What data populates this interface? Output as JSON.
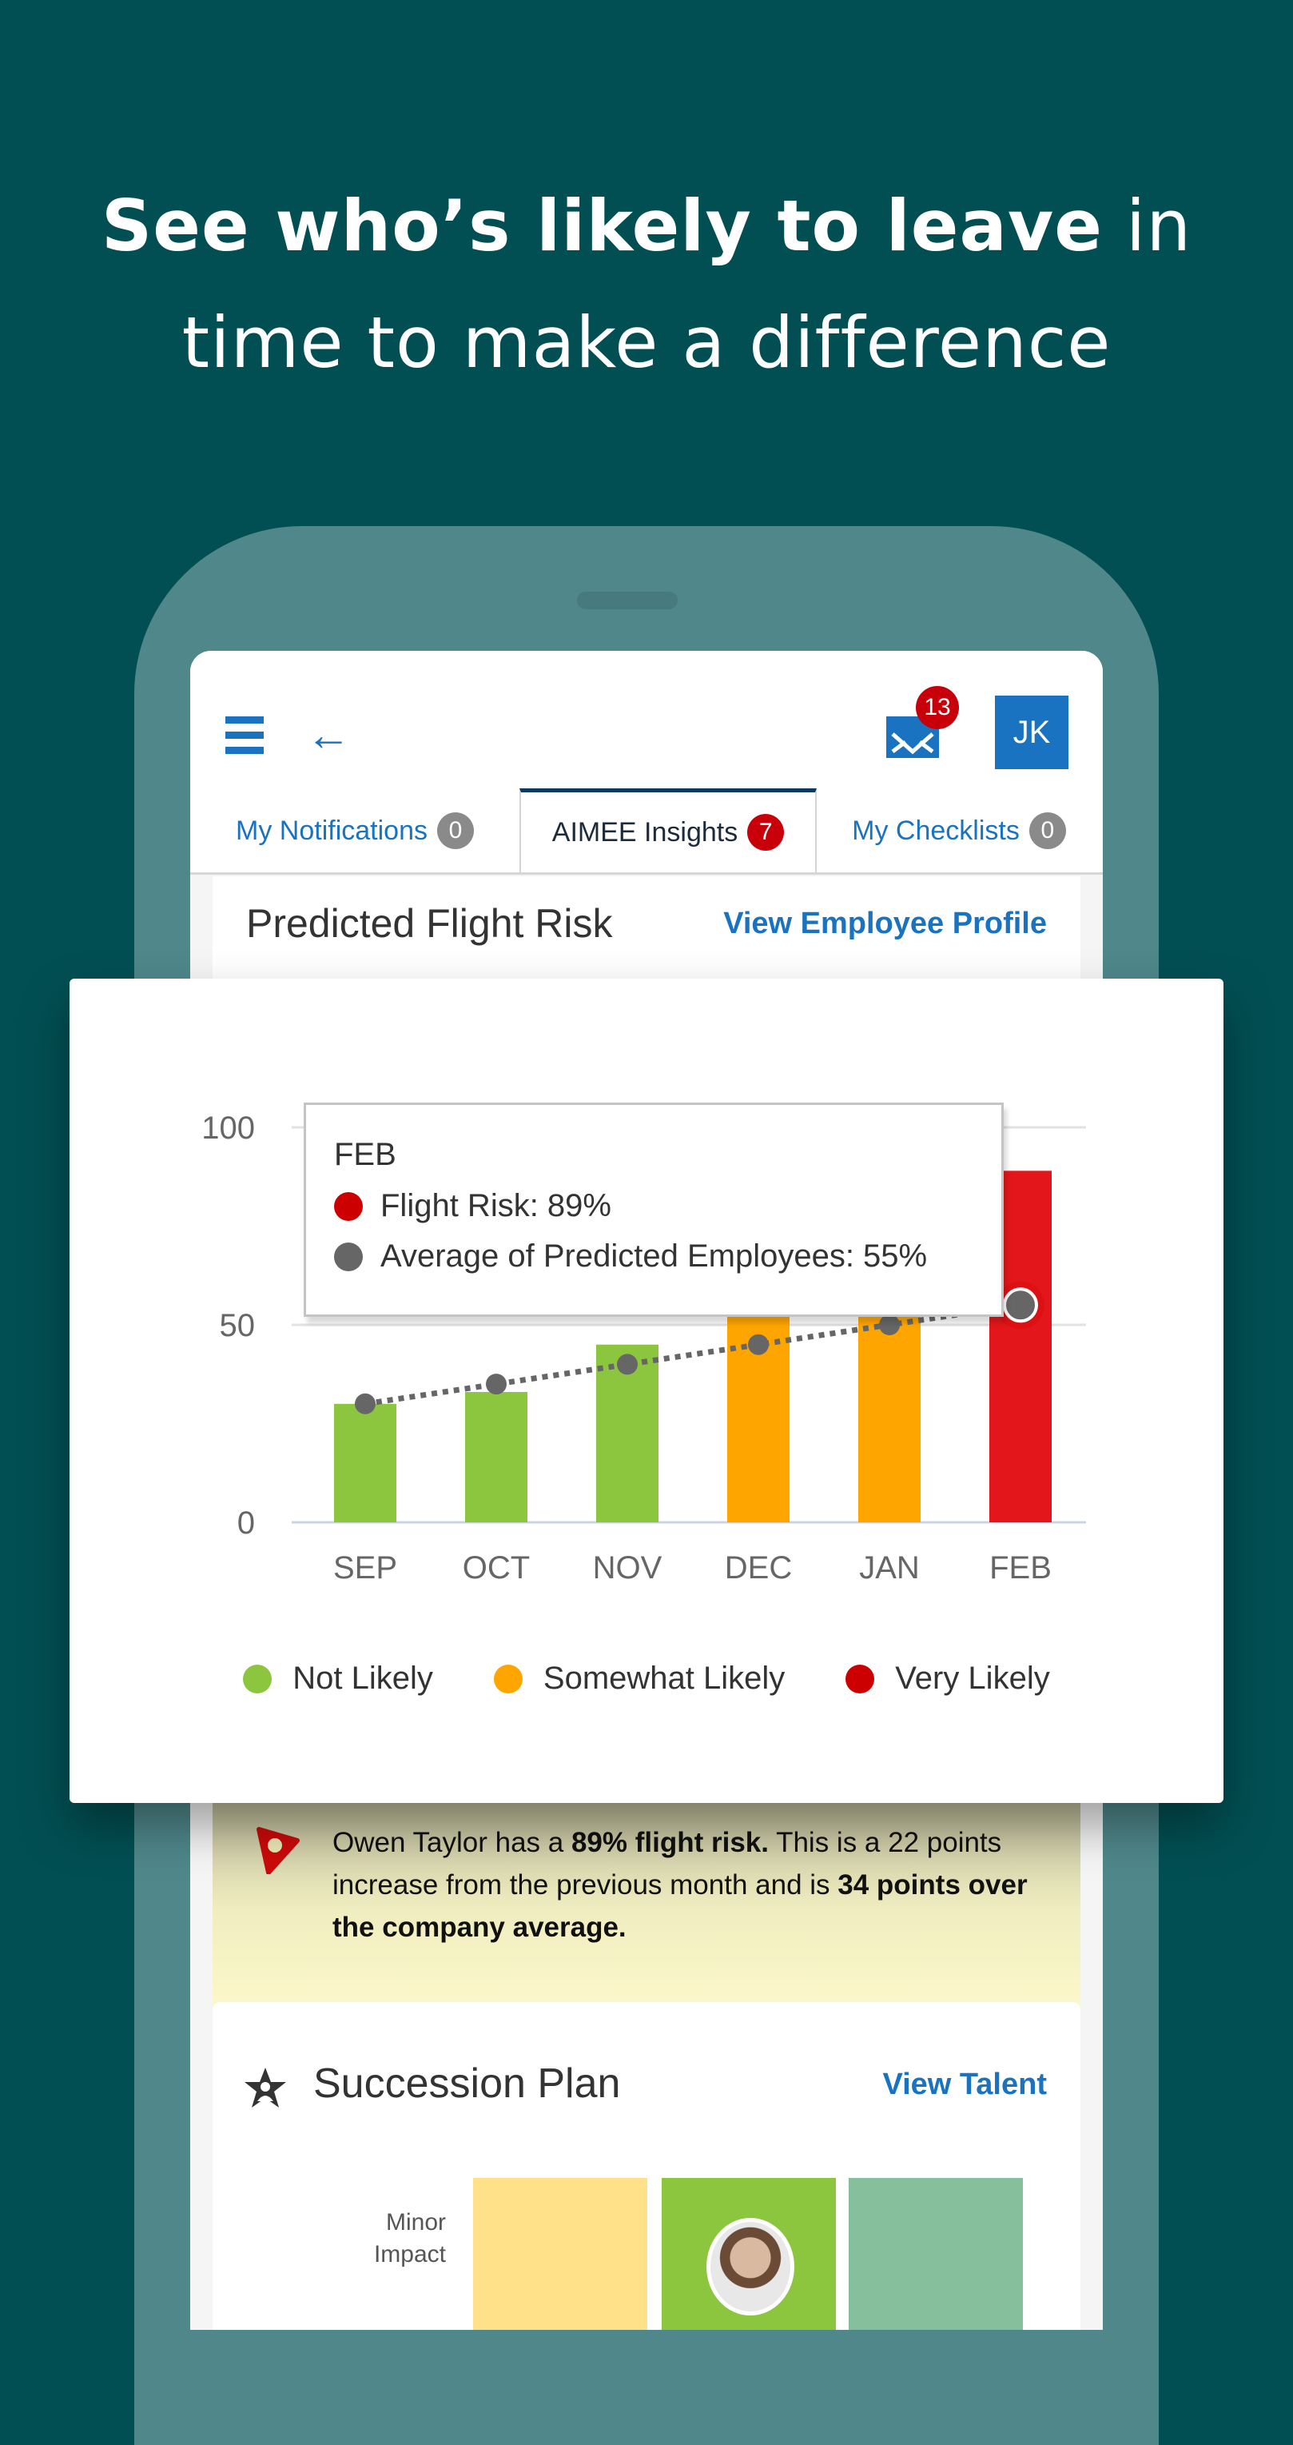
{
  "headline": {
    "bold": "See who’s likely to leave",
    "light_1": " in",
    "light_2": "time to make a difference"
  },
  "app": {
    "mail_badge": "13",
    "avatar_initials": "JK",
    "tabs": [
      {
        "label": "My Notifications",
        "count": "0",
        "active": false
      },
      {
        "label": "AIMEE Insights",
        "count": "7",
        "active": true
      },
      {
        "label": "My Checklists",
        "count": "0",
        "active": false
      }
    ],
    "flight_risk_card": {
      "title": "Predicted Flight Risk",
      "link": "View Employee Profile"
    },
    "insight": {
      "part1": "Owen Taylor has a ",
      "bold1": "89% flight risk.",
      "part2": " This is a 22 points increase from the previous month and is ",
      "bold2": "34 points over the company average."
    },
    "succession": {
      "title": "Succession Plan",
      "link": "View Talent",
      "row_label_1": "Minor",
      "row_label_2": "Impact",
      "cell_colors": [
        "#ffe18a",
        "#8cc63f",
        "#86bf9c"
      ]
    }
  },
  "colors": {
    "background": "#024f53",
    "accent_blue": "#1a73c1",
    "not_likely": "#8cc63f",
    "somewhat_likely": "#ffa500",
    "very_likely": "#e3171b",
    "average_line": "#666666",
    "badge_red": "#c8000a"
  },
  "chart_data": {
    "type": "bar",
    "title": "Predicted Flight Risk",
    "categories": [
      "SEP",
      "OCT",
      "NOV",
      "DEC",
      "JAN",
      "FEB"
    ],
    "series": [
      {
        "name": "Flight Risk",
        "type": "bar",
        "values": [
          30,
          33,
          45,
          58,
          67,
          89
        ],
        "risk_levels": [
          "Not Likely",
          "Not Likely",
          "Not Likely",
          "Somewhat Likely",
          "Somewhat Likely",
          "Very Likely"
        ]
      },
      {
        "name": "Average of Predicted Employees",
        "type": "line",
        "style": "dotted",
        "values": [
          30,
          35,
          40,
          45,
          50,
          55
        ]
      }
    ],
    "ylim": [
      0,
      100
    ],
    "yticks": [
      0,
      50,
      100
    ],
    "grid": true,
    "xlabel": "",
    "ylabel": "",
    "legend": {
      "placement": "bottom",
      "entries": [
        {
          "label": "Not Likely",
          "color": "#8cc63f"
        },
        {
          "label": "Somewhat Likely",
          "color": "#ffa500"
        },
        {
          "label": "Very Likely",
          "color": "#cc0000"
        }
      ]
    },
    "tooltip": {
      "title": "FEB",
      "rows": [
        {
          "label": "Flight Risk: 89%",
          "color": "#cc0000"
        },
        {
          "label": "Average of Predicted Employees: 55%",
          "color": "#666666"
        }
      ]
    }
  }
}
